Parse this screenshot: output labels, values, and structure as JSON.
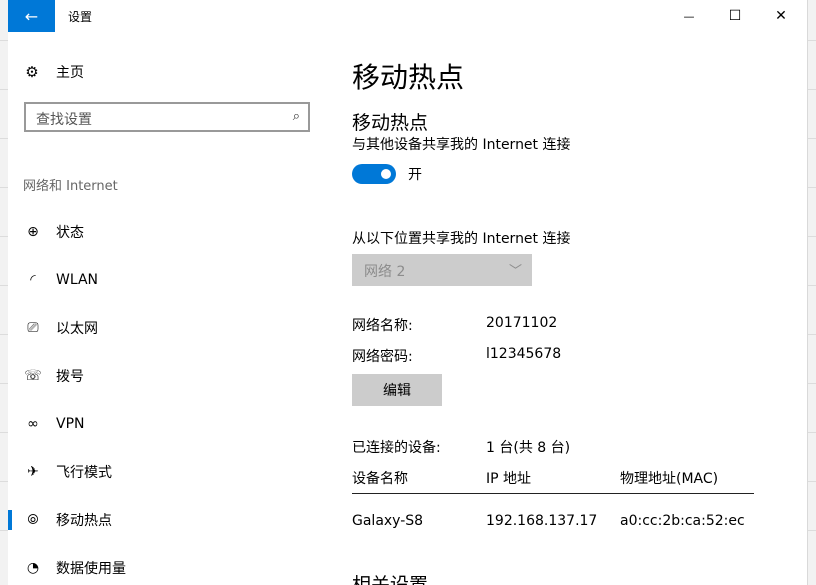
{
  "window": {
    "title": "设置",
    "back_glyph": "←",
    "minimize_glyph": "—",
    "maximize_glyph": "☐",
    "close_glyph": "✕"
  },
  "sidebar": {
    "home_label": "主页",
    "search_placeholder": "查找设置",
    "group_label": "网络和 Internet",
    "items": [
      {
        "label": "状态",
        "icon": "globe-icon",
        "glyph": "⊕"
      },
      {
        "label": "WLAN",
        "icon": "wifi-icon",
        "glyph": "◜"
      },
      {
        "label": "以太网",
        "icon": "ethernet-icon",
        "glyph": "⎚"
      },
      {
        "label": "拨号",
        "icon": "dialup-icon",
        "glyph": "☏"
      },
      {
        "label": "VPN",
        "icon": "vpn-icon",
        "glyph": "∞"
      },
      {
        "label": "飞行模式",
        "icon": "airplane-icon",
        "glyph": "✈"
      },
      {
        "label": "移动热点",
        "icon": "hotspot-icon",
        "glyph": "⦾"
      },
      {
        "label": "数据使用量",
        "icon": "data-usage-icon",
        "glyph": "◔"
      }
    ],
    "active_index": 6
  },
  "main": {
    "page_title": "移动热点",
    "section_title": "移动热点",
    "share_label": "与其他设备共享我的 Internet 连接",
    "toggle_state": "开",
    "from_label": "从以下位置共享我的 Internet 连接",
    "connection_select": "网络  2",
    "network_name_label": "网络名称:",
    "network_name": "20171102",
    "network_password_label": "网络密码:",
    "network_password": "l12345678",
    "edit_label": "编辑",
    "connected_label": "已连接的设备:",
    "connected_count": "1 台(共 8 台)",
    "table": {
      "headers": [
        "设备名称",
        "IP 地址",
        "物理地址(MAC)"
      ],
      "rows": [
        [
          "Galaxy-S8",
          "192.168.137.17",
          "a0:cc:2b:ca:52:ec"
        ]
      ]
    },
    "related_title": "相关设置"
  },
  "colors": {
    "accent": "#0078d7",
    "button_bg": "#cccccc"
  }
}
